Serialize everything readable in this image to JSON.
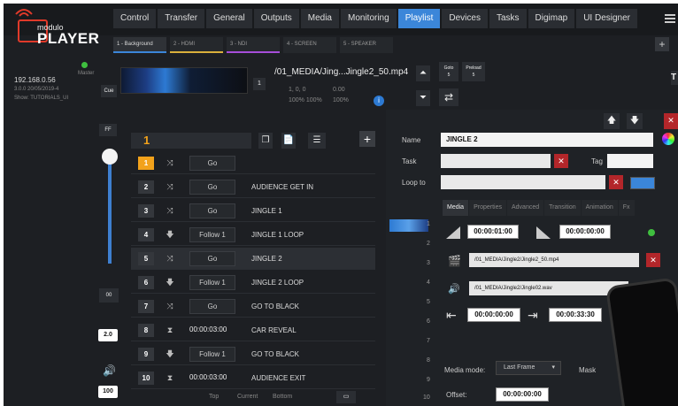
{
  "brand": {
    "small": "modulo",
    "big": "PLAYER"
  },
  "nav": [
    "Control",
    "Transfer",
    "General",
    "Outputs",
    "Media",
    "Monitoring",
    "Playlist",
    "Devices",
    "Tasks",
    "Digimap",
    "UI Designer"
  ],
  "nav_active": "Playlist",
  "playlist_tabs": [
    {
      "label": "1 - Background",
      "color": "#3b86d9"
    },
    {
      "label": "2 - HDMI",
      "color": "#d9b03b"
    },
    {
      "label": "3 - NDI",
      "color": "#a64dd9"
    },
    {
      "label": "4 - SCREEN",
      "color": ""
    },
    {
      "label": "5 - SPEAKER",
      "color": ""
    }
  ],
  "add_tab": "+",
  "server": {
    "ip": "192.168.0.56",
    "role": "Master",
    "build": "3.0.0 20/05/2019-4",
    "show": "Show: TUTORIALS_UI"
  },
  "cue_label": "Cue",
  "media": {
    "filename": "/01_MEDIA/Jing...Jingle2_50.mp4",
    "index": "1",
    "pos": "1,  0, 0",
    "rot": "0.00",
    "scale": "100% 100%",
    "opacity": "100%",
    "goto_label": "Goto",
    "goto_val": "5",
    "preload_label": "Preload",
    "preload_val": "5"
  },
  "left_controls": {
    "ff": "FF",
    "zero": "00",
    "speed": "2.0",
    "volume": "100"
  },
  "cue_field": "1",
  "add_btn": "+",
  "rows": [
    {
      "num": "1",
      "icon": "shuffle",
      "mode": "Go",
      "name": "",
      "active": true
    },
    {
      "num": "2",
      "icon": "shuffle",
      "mode": "Go",
      "name": "AUDIENCE GET IN"
    },
    {
      "num": "3",
      "icon": "shuffle",
      "mode": "Go",
      "name": "JINGLE 1"
    },
    {
      "num": "4",
      "icon": "arrow-down",
      "mode": "Follow 1",
      "name": "JINGLE 1 LOOP"
    },
    {
      "num": "5",
      "icon": "shuffle",
      "mode": "Go",
      "name": "JINGLE 2",
      "selected": true
    },
    {
      "num": "6",
      "icon": "arrow-down",
      "mode": "Follow 1",
      "name": "JINGLE 2 LOOP"
    },
    {
      "num": "7",
      "icon": "shuffle",
      "mode": "Go",
      "name": "GO TO BLACK"
    },
    {
      "num": "8",
      "icon": "hourglass",
      "mode": "00:00:03:00",
      "name": "CAR REVEAL"
    },
    {
      "num": "9",
      "icon": "arrow-down",
      "mode": "Follow 1",
      "name": "GO TO BLACK"
    },
    {
      "num": "10",
      "icon": "hourglass",
      "mode": "00:00:03:00",
      "name": "AUDIENCE EXIT"
    }
  ],
  "bottom_nav": [
    "Top",
    "Current",
    "Bottom"
  ],
  "props": {
    "name_label": "Name",
    "name_value": "JINGLE 2",
    "task_label": "Task",
    "tag_label": "Tag",
    "loopto_label": "Loop to",
    "tabs": [
      "Media",
      "Properties",
      "Advanced",
      "Transition",
      "Animation",
      "Fx"
    ],
    "fade_in": "00:00:01:00",
    "fade_out": "00:00:00:00",
    "video_path": "/01_MEDIA/Jingle2/Jingle2_50.mp4",
    "audio_path": "/01_MEDIA/Jingle2/Jingle02.wav",
    "in_point": "00:00:00:00",
    "out_point": "00:00:33:30",
    "media_mode_label": "Media mode:",
    "media_mode_value": "Last Frame",
    "mask_label": "Mask",
    "offset_label": "Offset:",
    "offset_value": "00:00:00:00"
  },
  "gutter_nums": [
    "1",
    "2",
    "3",
    "4",
    "5",
    "6",
    "7",
    "8",
    "9",
    "10"
  ]
}
